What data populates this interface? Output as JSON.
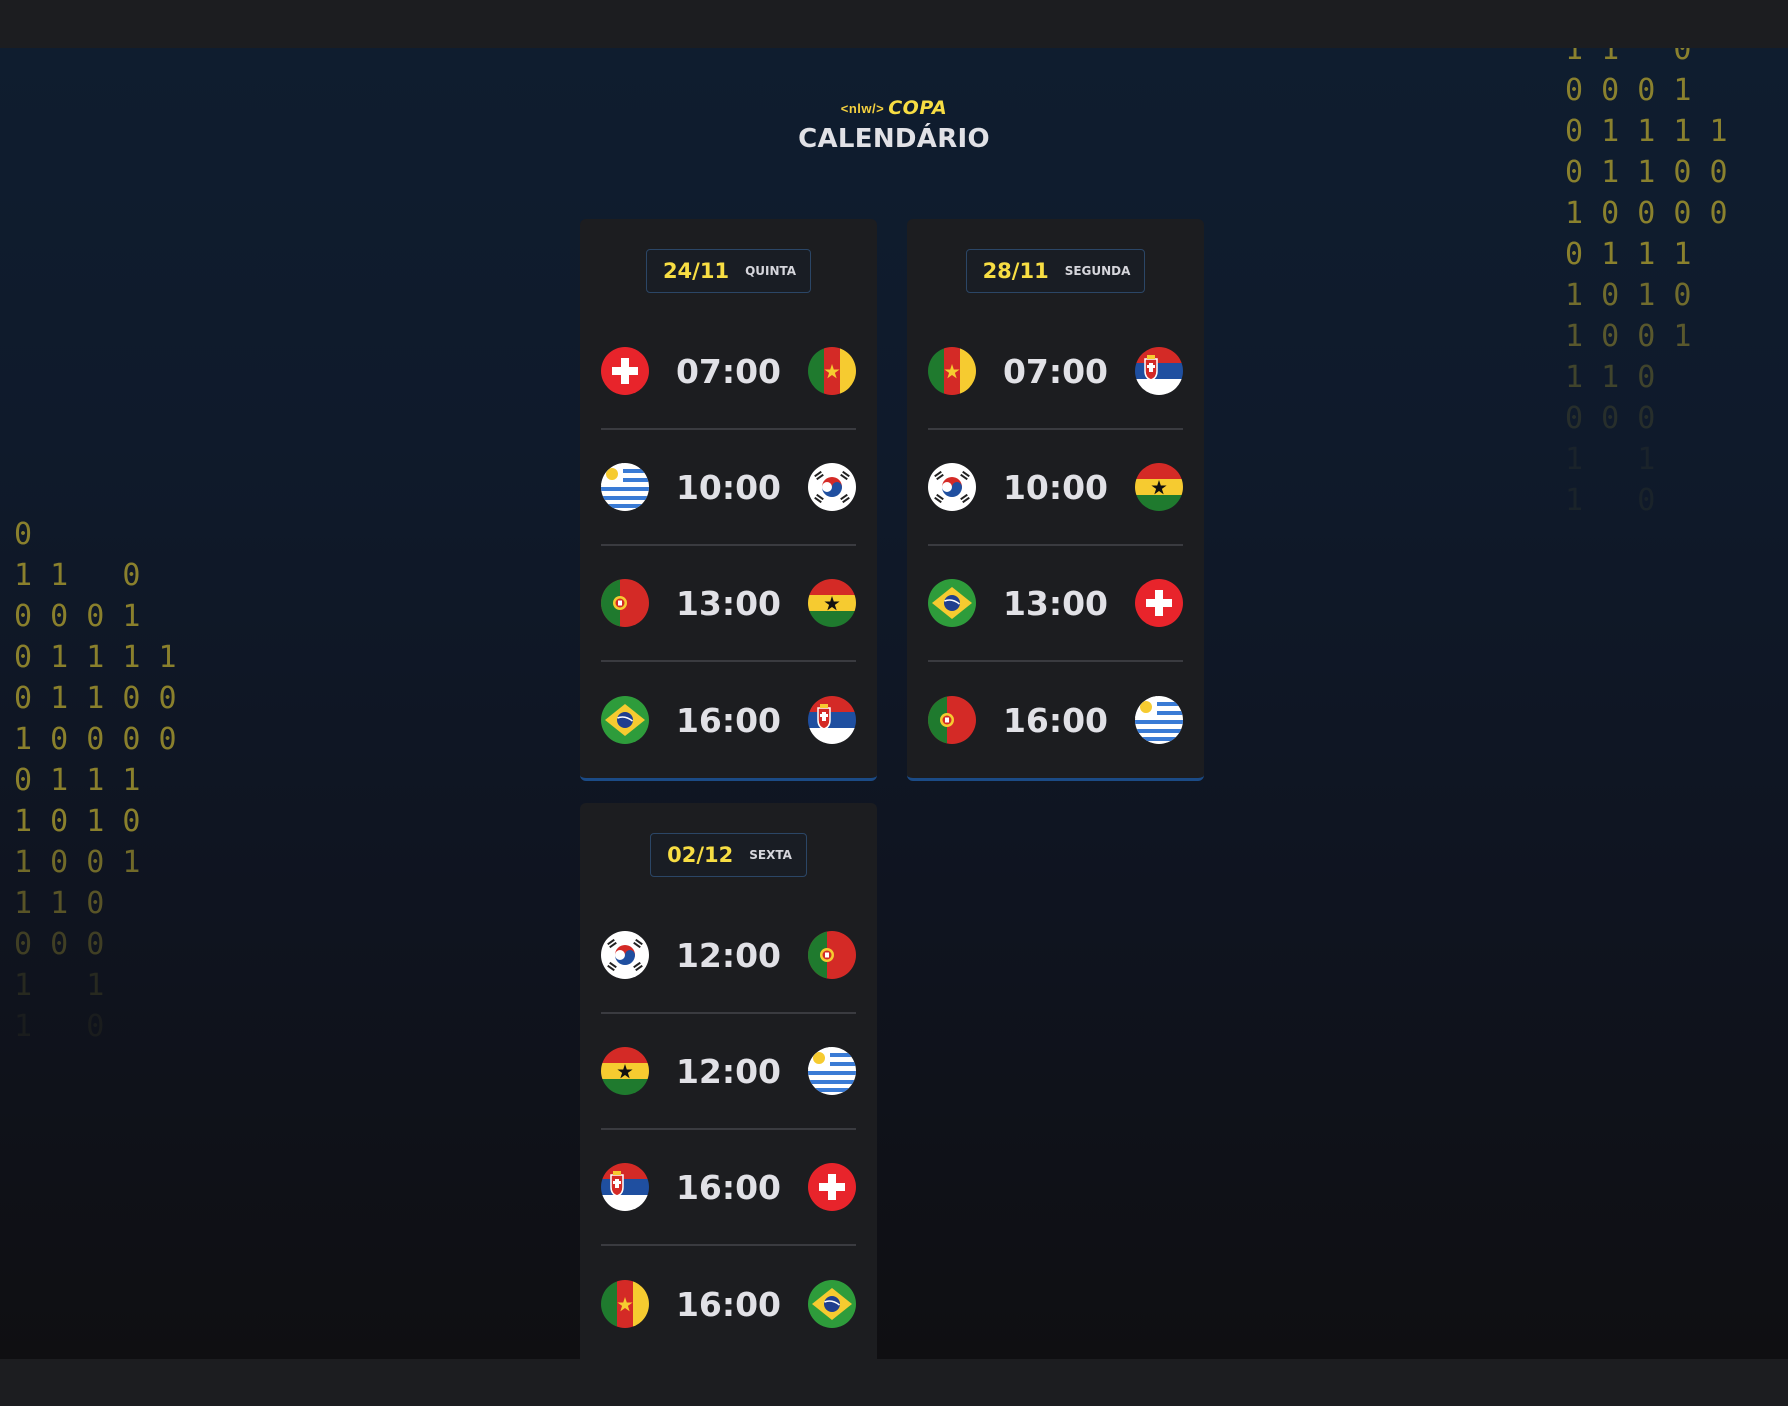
{
  "header": {
    "logo_code": "<nlw/>",
    "logo_name": "COPA",
    "title": "CALENDÁRIO"
  },
  "days": [
    {
      "date": "24/11",
      "weekday": "QUINTA",
      "games": [
        {
          "home": "switzerland",
          "time": "07:00",
          "away": "cameroon"
        },
        {
          "home": "uruguay",
          "time": "10:00",
          "away": "south-korea"
        },
        {
          "home": "portugal",
          "time": "13:00",
          "away": "ghana"
        },
        {
          "home": "brazil",
          "time": "16:00",
          "away": "serbia"
        }
      ]
    },
    {
      "date": "28/11",
      "weekday": "SEGUNDA",
      "games": [
        {
          "home": "cameroon",
          "time": "07:00",
          "away": "serbia"
        },
        {
          "home": "south-korea",
          "time": "10:00",
          "away": "ghana"
        },
        {
          "home": "brazil",
          "time": "13:00",
          "away": "switzerland"
        },
        {
          "home": "portugal",
          "time": "16:00",
          "away": "uruguay"
        }
      ]
    },
    {
      "date": "02/12",
      "weekday": "SEXTA",
      "games": [
        {
          "home": "south-korea",
          "time": "12:00",
          "away": "portugal"
        },
        {
          "home": "ghana",
          "time": "12:00",
          "away": "uruguay"
        },
        {
          "home": "serbia",
          "time": "16:00",
          "away": "switzerland"
        },
        {
          "home": "cameroon",
          "time": "16:00",
          "away": "brazil"
        }
      ]
    }
  ],
  "binary_left": [
    "0",
    "1 1   0",
    "0 0 0 1",
    "0 1 1 1 1",
    "0 1 1 0 0",
    "1 0 0 0 0",
    "0 1 1 1",
    "1 0 1 0",
    "1 0 0 1",
    "1 1 0",
    "0 0 0",
    "1   1",
    "1   0"
  ],
  "binary_right": [
    "1 1   0",
    "0 0 0 1",
    "0 1 1 1 1",
    "0 1 1 0 0",
    "1 0 0 0 0",
    "0 1 1 1",
    "1 0 1 0",
    "1 0 0 1",
    "1 1 0",
    "0 0 0",
    "1   1",
    "1   0"
  ],
  "colors": {
    "accent_yellow": "#f7dd43",
    "card_bg": "#1c1d20",
    "card_border": "#1b4b86",
    "text": "#e1e1e6"
  }
}
